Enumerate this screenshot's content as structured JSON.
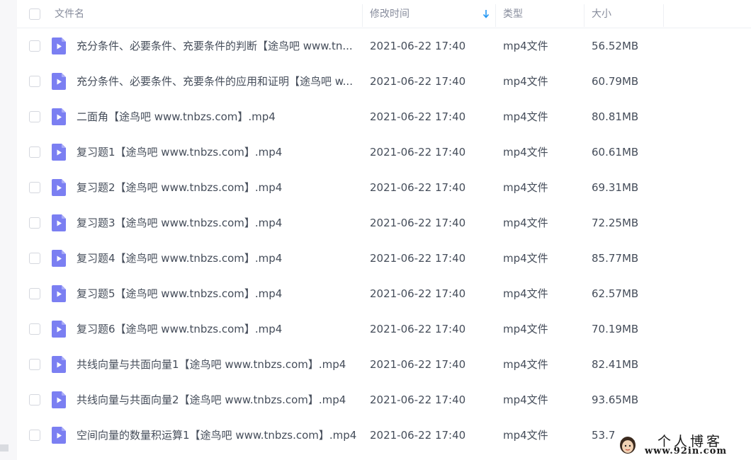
{
  "colors": {
    "accent": "#2196f3",
    "file_icon": "#7b7ff2",
    "text": "#454d5a",
    "header_text": "#878c9c"
  },
  "header": {
    "name_label": "文件名",
    "modified_label": "修改时间",
    "type_label": "类型",
    "size_label": "大小",
    "sort_icon": "arrow-down-icon"
  },
  "files": [
    {
      "name": "充分条件、必要条件、充要条件的判断【途鸟吧 www.tn...",
      "modified": "2021-06-22 17:40",
      "type": "mp4文件",
      "size": "56.52MB",
      "icon": "video-file-icon"
    },
    {
      "name": "充分条件、必要条件、充要条件的应用和证明【途鸟吧 w...",
      "modified": "2021-06-22 17:40",
      "type": "mp4文件",
      "size": "60.79MB",
      "icon": "video-file-icon"
    },
    {
      "name": "二面角【途鸟吧 www.tnbzs.com】.mp4",
      "modified": "2021-06-22 17:40",
      "type": "mp4文件",
      "size": "80.81MB",
      "icon": "video-file-icon"
    },
    {
      "name": "复习题1【途鸟吧 www.tnbzs.com】.mp4",
      "modified": "2021-06-22 17:40",
      "type": "mp4文件",
      "size": "60.61MB",
      "icon": "video-file-icon"
    },
    {
      "name": "复习题2【途鸟吧 www.tnbzs.com】.mp4",
      "modified": "2021-06-22 17:40",
      "type": "mp4文件",
      "size": "69.31MB",
      "icon": "video-file-icon"
    },
    {
      "name": "复习题3【途鸟吧 www.tnbzs.com】.mp4",
      "modified": "2021-06-22 17:40",
      "type": "mp4文件",
      "size": "72.25MB",
      "icon": "video-file-icon"
    },
    {
      "name": "复习题4【途鸟吧 www.tnbzs.com】.mp4",
      "modified": "2021-06-22 17:40",
      "type": "mp4文件",
      "size": "85.77MB",
      "icon": "video-file-icon"
    },
    {
      "name": "复习题5【途鸟吧 www.tnbzs.com】.mp4",
      "modified": "2021-06-22 17:40",
      "type": "mp4文件",
      "size": "62.57MB",
      "icon": "video-file-icon"
    },
    {
      "name": "复习题6【途鸟吧 www.tnbzs.com】.mp4",
      "modified": "2021-06-22 17:40",
      "type": "mp4文件",
      "size": "70.19MB",
      "icon": "video-file-icon"
    },
    {
      "name": "共线向量与共面向量1【途鸟吧 www.tnbzs.com】.mp4",
      "modified": "2021-06-22 17:40",
      "type": "mp4文件",
      "size": "82.41MB",
      "icon": "video-file-icon"
    },
    {
      "name": "共线向量与共面向量2【途鸟吧 www.tnbzs.com】.mp4",
      "modified": "2021-06-22 17:40",
      "type": "mp4文件",
      "size": "93.65MB",
      "icon": "video-file-icon"
    },
    {
      "name": "空间向量的数量积运算1【途鸟吧 www.tnbzs.com】.mp4",
      "modified": "2021-06-22 17:40",
      "type": "mp4文件",
      "size": "53.7",
      "icon": "video-file-icon"
    }
  ],
  "watermark": {
    "title": "个人博客",
    "url": "www.92in.com"
  }
}
